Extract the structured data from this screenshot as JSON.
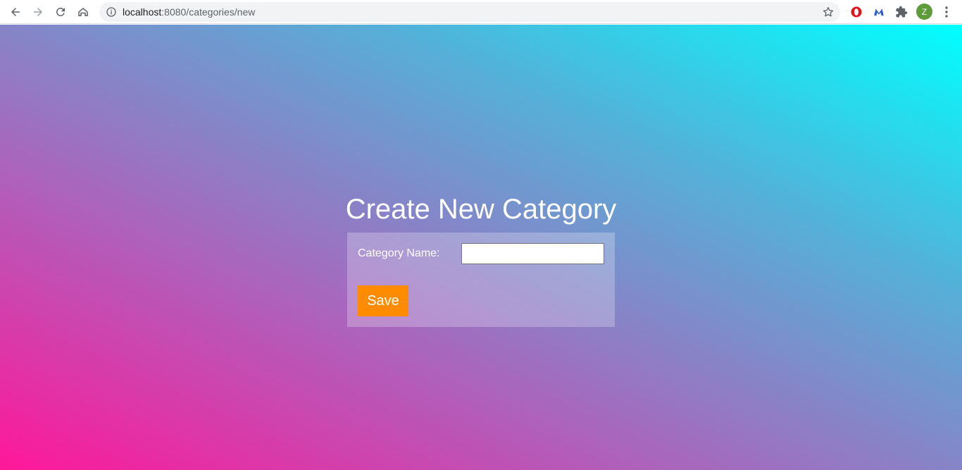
{
  "browser": {
    "url_host": "localhost",
    "url_path": ":8080/categories/new",
    "profile_initial": "Z",
    "colors": {
      "opera": "#e3141c",
      "malwarebytes": "#2a5bd7",
      "avatar": "#5e9b3a"
    },
    "icons": [
      "back-arrow-icon",
      "forward-arrow-icon",
      "reload-icon",
      "home-icon",
      "info-icon",
      "star-icon",
      "opera-extension-icon",
      "malwarebytes-extension-icon",
      "puzzle-icon",
      "kebab-menu-icon"
    ]
  },
  "page": {
    "title": "Create New Category",
    "form": {
      "category_label": "Category Name:",
      "category_value": "",
      "save_label": "Save"
    },
    "colors": {
      "save_button": "#ff8c00",
      "gradient_start": "#ff179a",
      "gradient_end": "#00ffff"
    }
  }
}
